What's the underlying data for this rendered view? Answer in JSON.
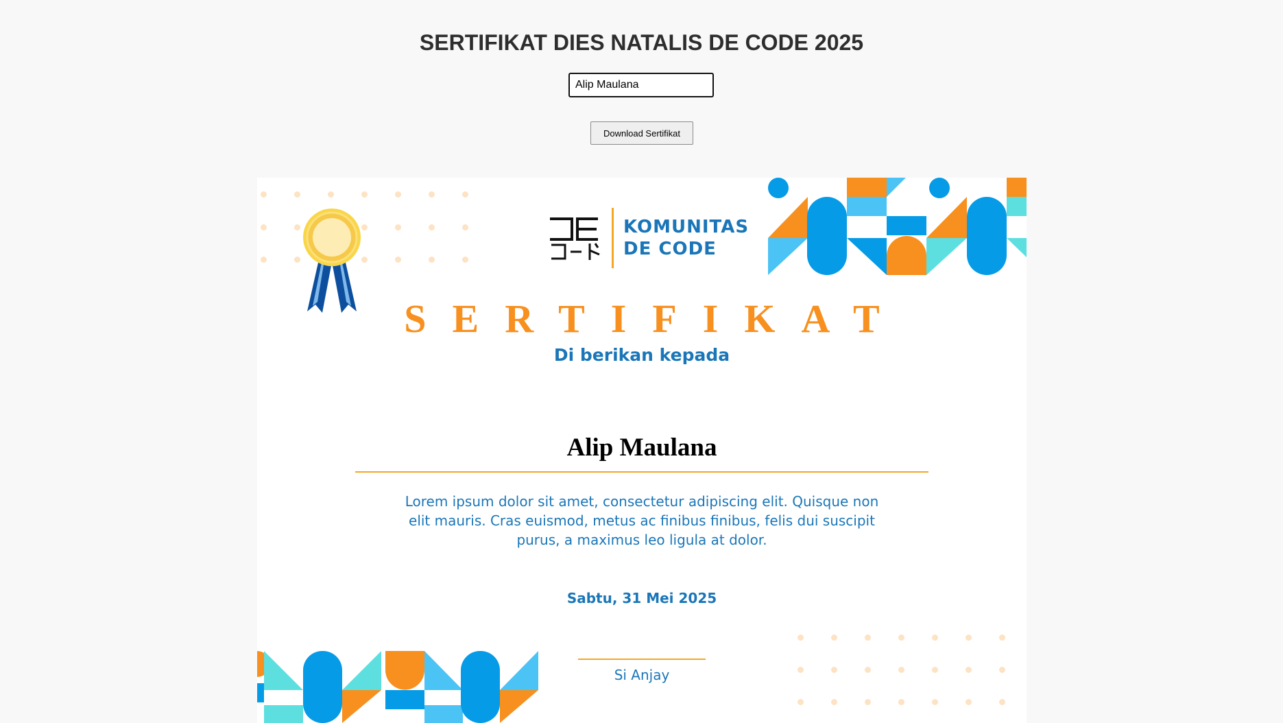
{
  "page": {
    "title": "SERTIFIKAT DIES NATALIS DE CODE 2025"
  },
  "form": {
    "name_value": "Alip Maulana",
    "download_label": "Download Sertifikat"
  },
  "certificate": {
    "logo": {
      "mark_latin": "DE",
      "mark_japanese": "コード",
      "org_line1": "KOMUNITAS",
      "org_line2": "DE CODE"
    },
    "heading": "SERTIFIKAT",
    "subheading": "Di berikan kepada",
    "recipient": "Alip Maulana",
    "description": "Lorem ipsum dolor sit amet, consectetur adipiscing elit. Quisque non elit mauris. Cras euismod, metus ac finibus finibus, felis dui suscipit purus, a maximus leo ligula at dolor.",
    "date": "Sabtu, 31 Mei 2025",
    "signer": "Si Anjay"
  },
  "colors": {
    "orange": "#f7901e",
    "blue": "#1a76b8",
    "sky": "#069be6",
    "light_sky": "#4cc3f5",
    "teal": "#5ddfe0",
    "dot": "#fde3c3"
  }
}
